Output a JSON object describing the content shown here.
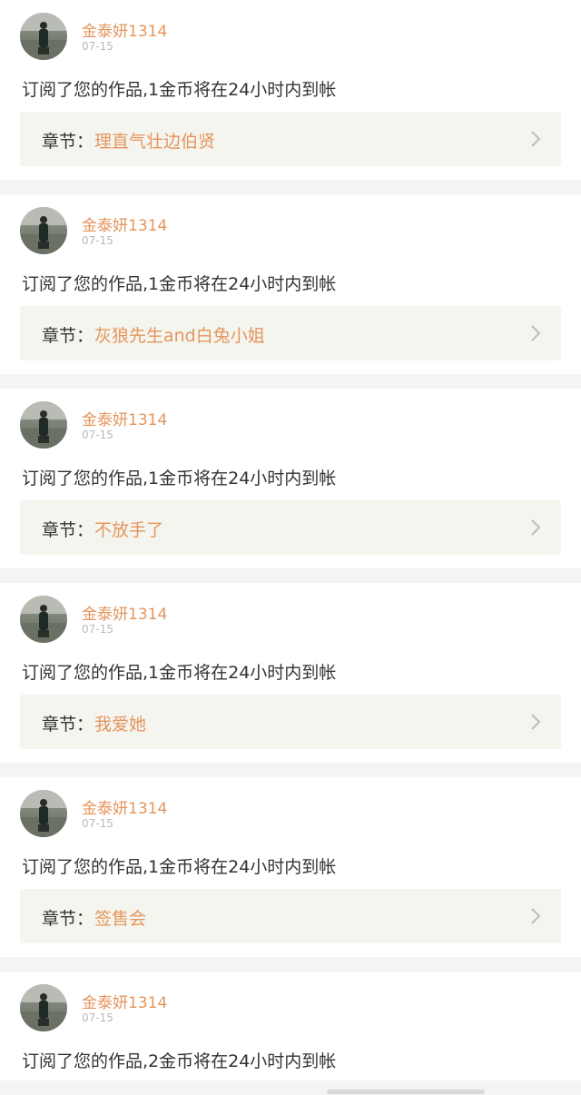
{
  "colors": {
    "accent": "#e4955d",
    "text": "#333333",
    "muted": "#b9b9b9",
    "chapter_bg": "#f5f5ef",
    "page_bg": "#f4f4f4"
  },
  "icons": {
    "avatar": "user-avatar-photo",
    "chevron": "chevron-right-icon"
  },
  "notifications": [
    {
      "username": "金泰妍1314",
      "date": "07-15",
      "message": "订阅了您的作品,1金币将在24小时内到帐",
      "chapter_prefix": "章节：",
      "chapter_title": "理直气壮边伯贤"
    },
    {
      "username": "金泰妍1314",
      "date": "07-15",
      "message": "订阅了您的作品,1金币将在24小时内到帐",
      "chapter_prefix": "章节：",
      "chapter_title": "灰狼先生and白兔小姐"
    },
    {
      "username": "金泰妍1314",
      "date": "07-15",
      "message": "订阅了您的作品,1金币将在24小时内到帐",
      "chapter_prefix": "章节：",
      "chapter_title": "不放手了"
    },
    {
      "username": "金泰妍1314",
      "date": "07-15",
      "message": "订阅了您的作品,1金币将在24小时内到帐",
      "chapter_prefix": "章节：",
      "chapter_title": "我爱她"
    },
    {
      "username": "金泰妍1314",
      "date": "07-15",
      "message": "订阅了您的作品,1金币将在24小时内到帐",
      "chapter_prefix": "章节：",
      "chapter_title": "签售会"
    },
    {
      "username": "金泰妍1314",
      "date": "07-15",
      "message": "订阅了您的作品,2金币将在24小时内到帐"
    }
  ]
}
